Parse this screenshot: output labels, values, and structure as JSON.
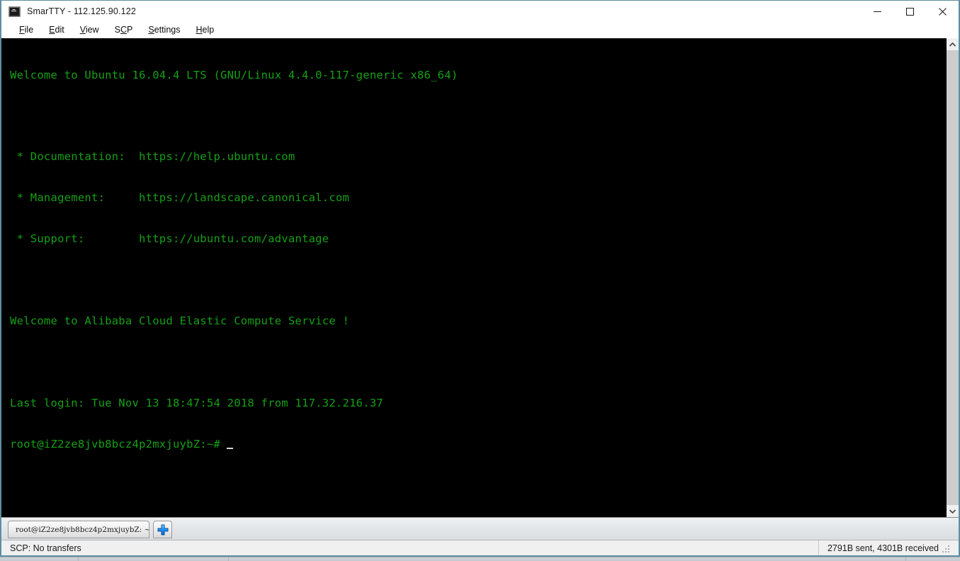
{
  "window": {
    "title": "SmarTTY - 112.125.90.122",
    "app_name": "SmarTTY",
    "host": "112.125.90.122",
    "icon": "terminal-icon",
    "accent_border_color": "#5d8fa0"
  },
  "title_buttons": {
    "minimize_label": "Minimize",
    "maximize_label": "Maximize",
    "close_label": "Close"
  },
  "menubar": {
    "items": [
      {
        "label": "File",
        "mnemonic": "F"
      },
      {
        "label": "Edit",
        "mnemonic": "E"
      },
      {
        "label": "View",
        "mnemonic": "V"
      },
      {
        "label": "SCP",
        "mnemonic": "C"
      },
      {
        "label": "Settings",
        "mnemonic": "S"
      },
      {
        "label": "Help",
        "mnemonic": "H"
      }
    ]
  },
  "terminal": {
    "background_color": "#000000",
    "foreground_color": "#15a015",
    "cursor_color": "#d8d8d8",
    "lines": [
      "Welcome to Ubuntu 16.04.4 LTS (GNU/Linux 4.4.0-117-generic x86_64)",
      "",
      " * Documentation:  https://help.ubuntu.com",
      " * Management:     https://landscape.canonical.com",
      " * Support:        https://ubuntu.com/advantage",
      "",
      "Welcome to Alibaba Cloud Elastic Compute Service !",
      "",
      "Last login: Tue Nov 13 18:47:54 2018 from 117.32.216.37"
    ],
    "prompt": "root@iZ2ze8jvb8bcz4p2mxjuybZ:~#"
  },
  "scrollbar": {
    "up_arrow": "chevron-up-icon",
    "down_arrow": "chevron-down-icon"
  },
  "tabbar": {
    "tabs": [
      {
        "label": "root@iZ2ze8jvb8bcz4p2mxjuybZ: ~",
        "active": true
      }
    ],
    "new_tab_label": "+"
  },
  "statusbar": {
    "scp_status": "SCP: No transfers",
    "traffic": "2791B sent, 4301B received"
  }
}
